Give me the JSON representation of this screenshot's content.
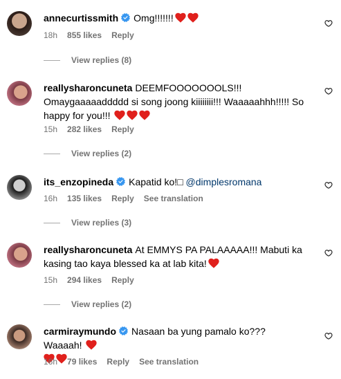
{
  "comments": [
    {
      "username": "annecurtissmith",
      "verified": true,
      "text": "Omg!!!!!!!",
      "hearts": 2,
      "time": "18h",
      "likes": "855 likes",
      "reply": "Reply",
      "view_replies": "View replies (8)"
    },
    {
      "username": "reallysharoncuneta",
      "verified": false,
      "text": "DEEMFOOOOOOOLS!!! Omaygaaaaaddddd si song joong kiiiiiiii!!! Waaaaahhh!!!!! So happy for you!!!",
      "hearts": 3,
      "time": "15h",
      "likes": "282 likes",
      "reply": "Reply",
      "view_replies": "View replies (2)"
    },
    {
      "username": "its_enzopineda",
      "verified": true,
      "text": "Kapatid ko!□",
      "mention": "@dimplesromana",
      "hearts": 0,
      "time": "16h",
      "likes": "135 likes",
      "reply": "Reply",
      "see_translation": "See translation",
      "view_replies": "View replies (3)"
    },
    {
      "username": "reallysharoncuneta",
      "verified": false,
      "text": "At EMMYS PA PALAAAAA!!! Mabuti ka kasing tao kaya blessed ka at lab kita!",
      "hearts": 1,
      "time": "15h",
      "likes": "294 likes",
      "reply": "Reply",
      "view_replies": "View replies (2)"
    },
    {
      "username": "carmiraymundo",
      "verified": true,
      "text": "Nasaan ba yung pamalo ko??? Waaaah!",
      "hearts": 3,
      "time": "16h",
      "likes": "79 likes",
      "reply": "Reply",
      "see_translation": "See translation"
    }
  ],
  "colors": {
    "heart": "#e0201c",
    "verified": "#3897f0",
    "mention": "#00376b",
    "meta": "#737373"
  }
}
